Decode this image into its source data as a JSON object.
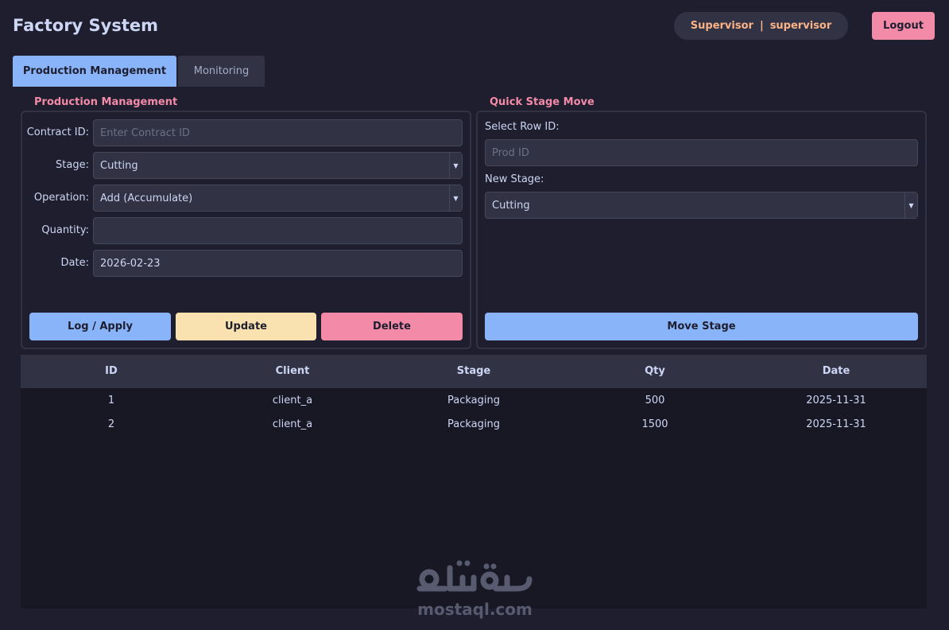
{
  "header": {
    "title": "Factory System",
    "role": "Supervisor",
    "separator": "|",
    "username": "supervisor",
    "logout_label": "Logout"
  },
  "tabs": [
    {
      "label": "Production Management",
      "active": true
    },
    {
      "label": "Monitoring",
      "active": false
    }
  ],
  "production": {
    "group_title": "Production Management",
    "contract_label": "Contract ID:",
    "contract_placeholder": "Enter Contract ID",
    "stage_label": "Stage:",
    "stage_value": "Cutting",
    "operation_label": "Operation:",
    "operation_value": "Add (Accumulate)",
    "quantity_label": "Quantity:",
    "quantity_value": "",
    "date_label": "Date:",
    "date_value": "2026-02-23",
    "log_label": "Log / Apply",
    "update_label": "Update",
    "delete_label": "Delete"
  },
  "quick_move": {
    "group_title": "Quick Stage Move",
    "row_label": "Select Row ID:",
    "row_placeholder": "Prod ID",
    "new_stage_label": "New Stage:",
    "new_stage_value": "Cutting",
    "move_label": "Move Stage"
  },
  "table": {
    "columns": [
      "ID",
      "Client",
      "Stage",
      "Qty",
      "Date"
    ],
    "rows": [
      [
        "1",
        "client_a",
        "Packaging",
        "500",
        "2025-11-31"
      ],
      [
        "2",
        "client_a",
        "Packaging",
        "1500",
        "2025-11-31"
      ]
    ]
  },
  "watermark": {
    "text": "mostaql.com",
    "logo_text": "مستقل"
  },
  "colors": {
    "background": "#1e1e2e",
    "accent_blue": "#89b4fa",
    "accent_pink": "#f38ba8",
    "accent_yellow": "#f9e2af",
    "accent_orange": "#fab387"
  }
}
